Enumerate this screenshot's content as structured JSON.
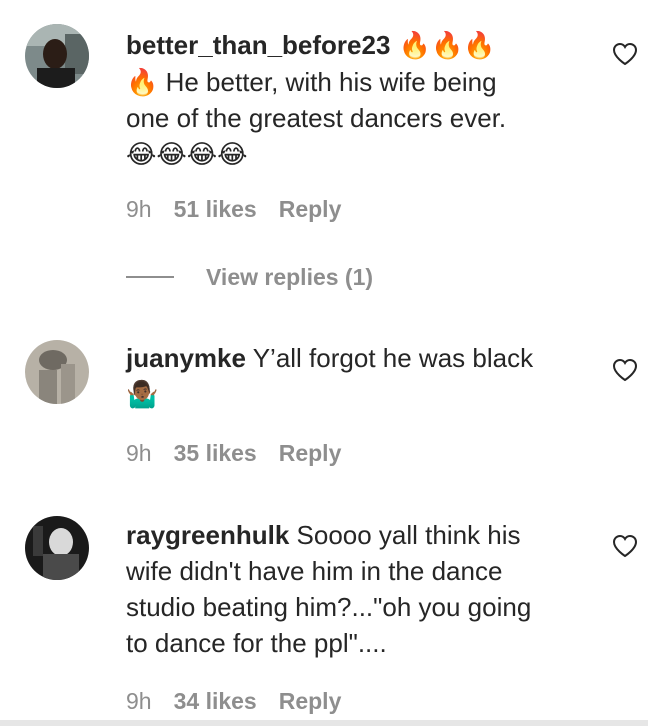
{
  "comments": [
    {
      "username": "better_than_before23",
      "text_lines": [
        " 🔥🔥🔥",
        "🔥 He better, with his wife being",
        "one of the greatest dancers ever.",
        "😂😂😂😂"
      ],
      "time": "9h",
      "likes": "51 likes",
      "reply_label": "Reply",
      "view_replies": "View replies (1)"
    },
    {
      "username": "juanymke",
      "text_lines": [
        " Y’all forgot he was black",
        "🤷🏾‍♂️"
      ],
      "time": "9h",
      "likes": "35 likes",
      "reply_label": "Reply"
    },
    {
      "username": "raygreenhulk",
      "text_lines": [
        " Soooo yall think his",
        "wife didn't have him in the dance",
        "studio beating him?...\"oh you going",
        "to dance for the ppl\"...."
      ],
      "time": "9h",
      "likes": "34 likes",
      "reply_label": "Reply"
    }
  ],
  "icons": {
    "like": "heart-outline-icon"
  },
  "colors": {
    "text": "#262626",
    "muted": "#8e8e8e"
  }
}
